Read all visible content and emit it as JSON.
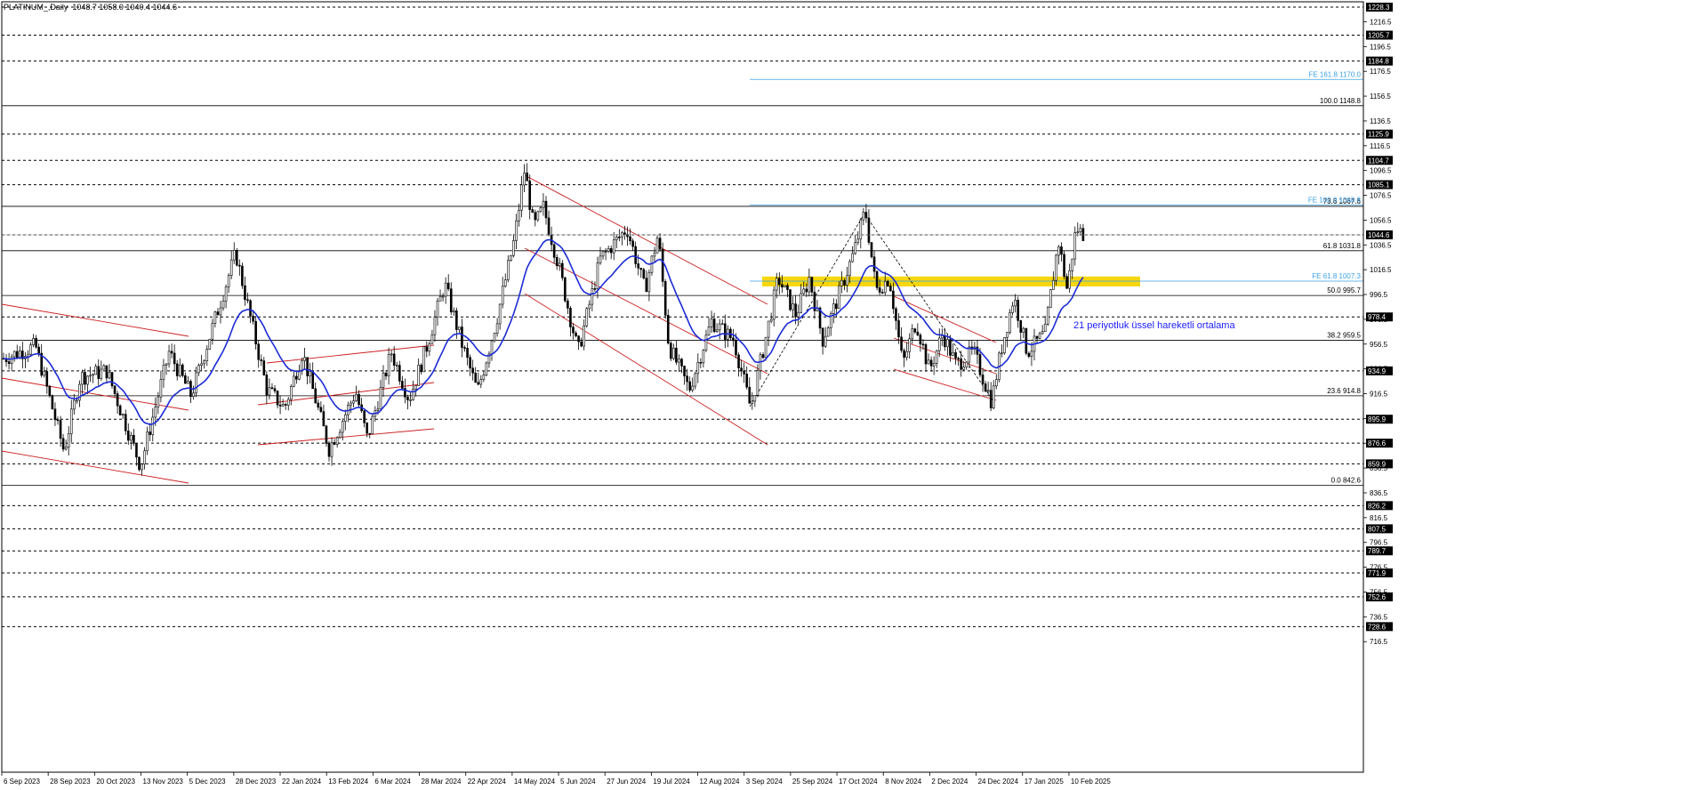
{
  "header": {
    "symbol": "PLATINUM_,Daily",
    "ohlc": "1048.7 1058.0 1040.4 1044.6"
  },
  "annotation": "21 periyotluk üssel hareketli ortalama",
  "colors": {
    "candle": "#000000",
    "ema": "#1b2bd6",
    "channel": "#cc1f1f",
    "fib": "#000000",
    "fe": "#3aa0e8",
    "zone": "#f6d400",
    "grid": "#000000"
  },
  "chart_data": {
    "type": "candlestick",
    "price_range": [
      710,
      1240
    ],
    "x_tick_labels": [
      "6 Sep 2023",
      "28 Sep 2023",
      "20 Oct 2023",
      "13 Nov 2023",
      "5 Dec 2023",
      "28 Dec 2023",
      "22 Jan 2024",
      "13 Feb 2024",
      "6 Mar 2024",
      "28 Mar 2024",
      "22 Apr 2024",
      "14 May 2024",
      "5 Jun 2024",
      "27 Jun 2024",
      "19 Jul 2024",
      "12 Aug 2024",
      "3 Sep 2024",
      "25 Sep 2024",
      "17 Oct 2024",
      "8 Nov 2024",
      "2 Dec 2024",
      "24 Dec 2024",
      "17 Jan 2025",
      "10 Feb 2025"
    ],
    "y_tick_labels": [
      1216.5,
      1196.5,
      1176.5,
      1156.5,
      1136.5,
      1116.5,
      1096.5,
      1076.5,
      1056.5,
      1036.5,
      1016.5,
      996.5,
      976.5,
      956.5,
      936.5,
      916.5,
      896.5,
      876.5,
      856.5,
      836.5,
      816.5,
      796.5,
      776.5,
      756.5,
      736.5,
      716.5
    ],
    "horizontal_levels": [
      1228.3,
      1205.7,
      1184.8,
      1125.9,
      1104.7,
      1085.1,
      1044.6,
      978.4,
      934.9,
      895.9,
      876.6,
      859.9,
      826.2,
      807.5,
      789.7,
      771.9,
      752.6,
      728.6
    ],
    "current_price": 1044.6,
    "fibonacci": [
      {
        "label": "100.0",
        "value": 1148.8
      },
      {
        "label": "73.6",
        "value": 1067.6
      },
      {
        "label": "61.8",
        "value": 1031.8
      },
      {
        "label": "50.0",
        "value": 995.7
      },
      {
        "label": "38.2",
        "value": 959.5
      },
      {
        "label": "23.6",
        "value": 914.8
      },
      {
        "label": "0.0",
        "value": 842.6
      }
    ],
    "fibonacci_expansion": [
      {
        "label": "FE 161.8",
        "value": 1170.0
      },
      {
        "label": "FE 100.0",
        "value": 1068.8
      },
      {
        "label": "FE 61.8",
        "value": 1007.3
      }
    ],
    "support_zone": [
      1003,
      1011
    ],
    "indicator": "EMA 21"
  }
}
